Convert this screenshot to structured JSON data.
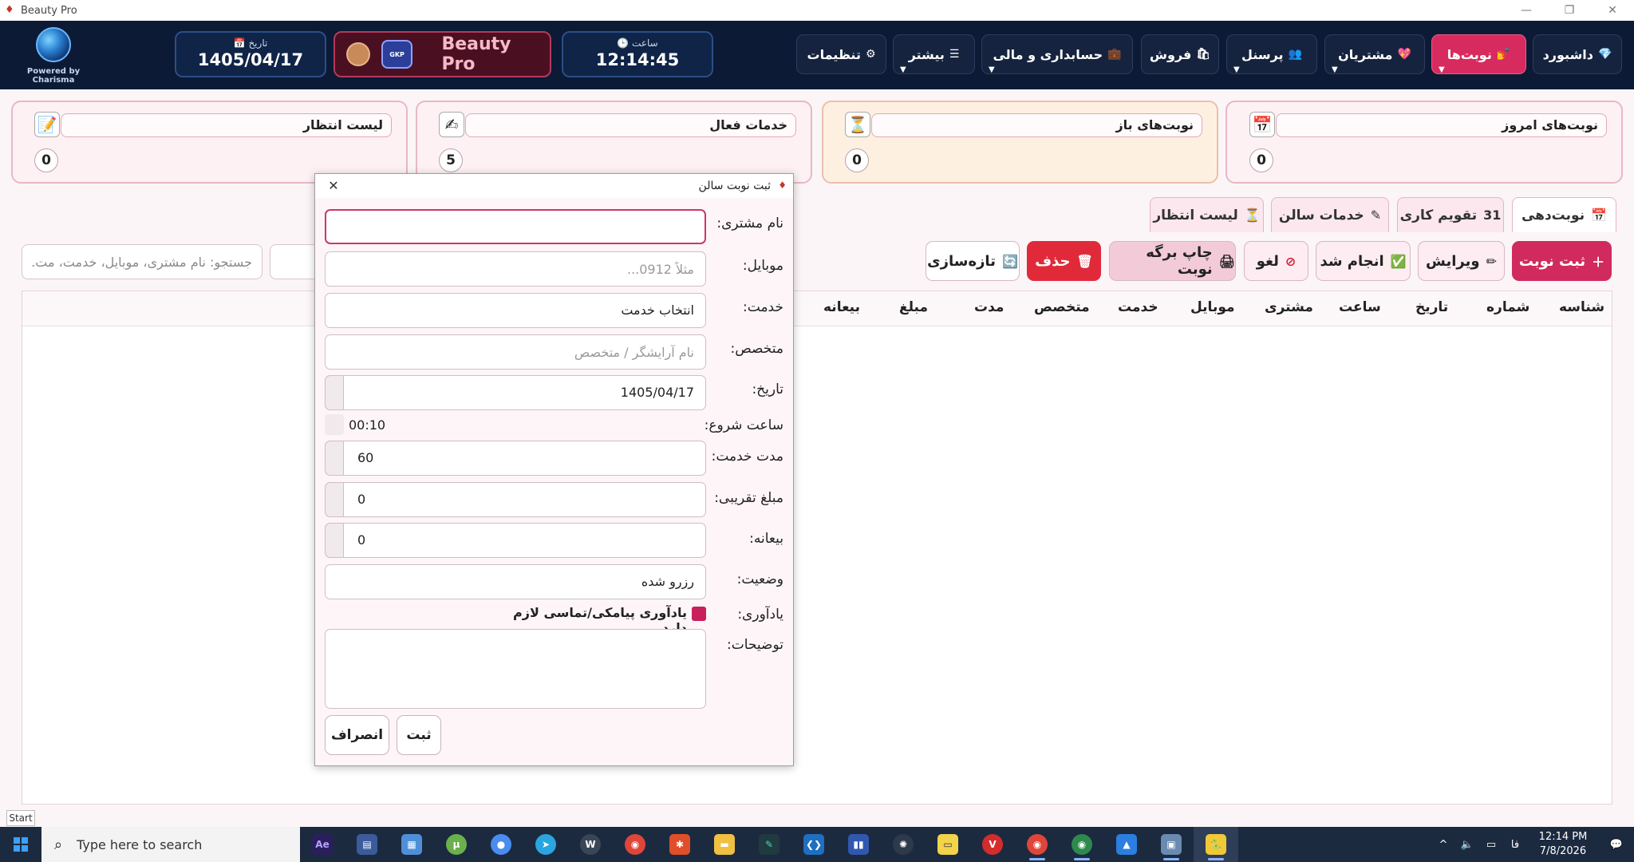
{
  "window": {
    "title": "Beauty Pro",
    "minimize": "—",
    "restore": "❐",
    "close": "✕"
  },
  "header": {
    "logo_text": "Powered by Charisma",
    "date_label": "📅 تاریخ",
    "date_value": "1405/04/17",
    "brand_name": "Beauty Pro",
    "brand_badge": "GKP",
    "time_label": "🕒 ساعت",
    "time_value": "12:14:45",
    "nav": [
      {
        "label": "داشبورد",
        "icon": "💎"
      },
      {
        "label": "نوبت‌ها",
        "icon": "💅"
      },
      {
        "label": "مشتریان",
        "icon": "💖"
      },
      {
        "label": "پرسنل",
        "icon": "👥"
      },
      {
        "label": "فروش",
        "icon": "🛍"
      },
      {
        "label": "حسابداری و مالی",
        "icon": "💼"
      },
      {
        "label": "بیشتر",
        "icon": "☰"
      },
      {
        "label": "تنظیمات",
        "icon": "⚙"
      }
    ]
  },
  "stats": [
    {
      "label": "نوبت‌های امروز",
      "count": "0",
      "icon": "📅"
    },
    {
      "label": "نوبت‌های باز",
      "count": "0",
      "icon": "⏳"
    },
    {
      "label": "خدمات فعال",
      "count": "5",
      "icon": "✍"
    },
    {
      "label": "لیست انتظار",
      "count": "0",
      "icon": "📝"
    }
  ],
  "tabs": [
    {
      "label": "نوبت‌دهی",
      "icon": "📅"
    },
    {
      "label": "تقویم کاری",
      "icon": "31"
    },
    {
      "label": "خدمات سالن",
      "icon": "✎"
    },
    {
      "label": "لیست انتظار",
      "icon": "⏳"
    }
  ],
  "search": {
    "placeholder": "جستجو: نام مشتری، موبایل، خدمت، مت..."
  },
  "actions": {
    "add": "ثبت نوبت",
    "edit": "ویرایش",
    "done": "انجام شد",
    "cancel": "لغو",
    "print": "چاپ برگه نوبت",
    "delete": "حذف",
    "refresh": "تازه‌سازی"
  },
  "table": {
    "columns": [
      "شناسه",
      "شماره",
      "تاریخ",
      "ساعت",
      "مشتری",
      "موبایل",
      "خدمت",
      "متخصص",
      "مدت",
      "مبلغ",
      "بیعانه"
    ]
  },
  "dialog": {
    "title": "ثبت نوبت سالن",
    "close": "✕",
    "fields": {
      "customer_label": "نام مشتری:",
      "customer_value": "",
      "mobile_label": "موبایل:",
      "mobile_placeholder": "مثلاً 0912...",
      "service_label": "خدمت:",
      "service_value": "انتخاب خدمت",
      "specialist_label": "متخصص:",
      "specialist_placeholder": "نام آرایشگر / متخصص",
      "date_label": "تاریخ:",
      "date_value": "1405/04/17",
      "start_label": "ساعت شروع:",
      "start_value": "00:10",
      "duration_label": "مدت خدمت:",
      "duration_value": "60",
      "price_label": "مبلغ تقریبی:",
      "price_value": "0",
      "deposit_label": "بیعانه:",
      "deposit_value": "0",
      "status_label": "وضعیت:",
      "status_value": "رزرو شده",
      "reminder_label": "یادآوری:",
      "reminder_text": "یادآوری پیامکی/تماسی لازم دارد",
      "notes_label": "توضیحات:"
    },
    "submit": "ثبت",
    "dismiss": "انصراف"
  },
  "start_tag": "Start",
  "taskbar": {
    "search_placeholder": "Type here to search",
    "lang": "فا",
    "time": "12:14 PM",
    "date": "7/8/2026"
  }
}
